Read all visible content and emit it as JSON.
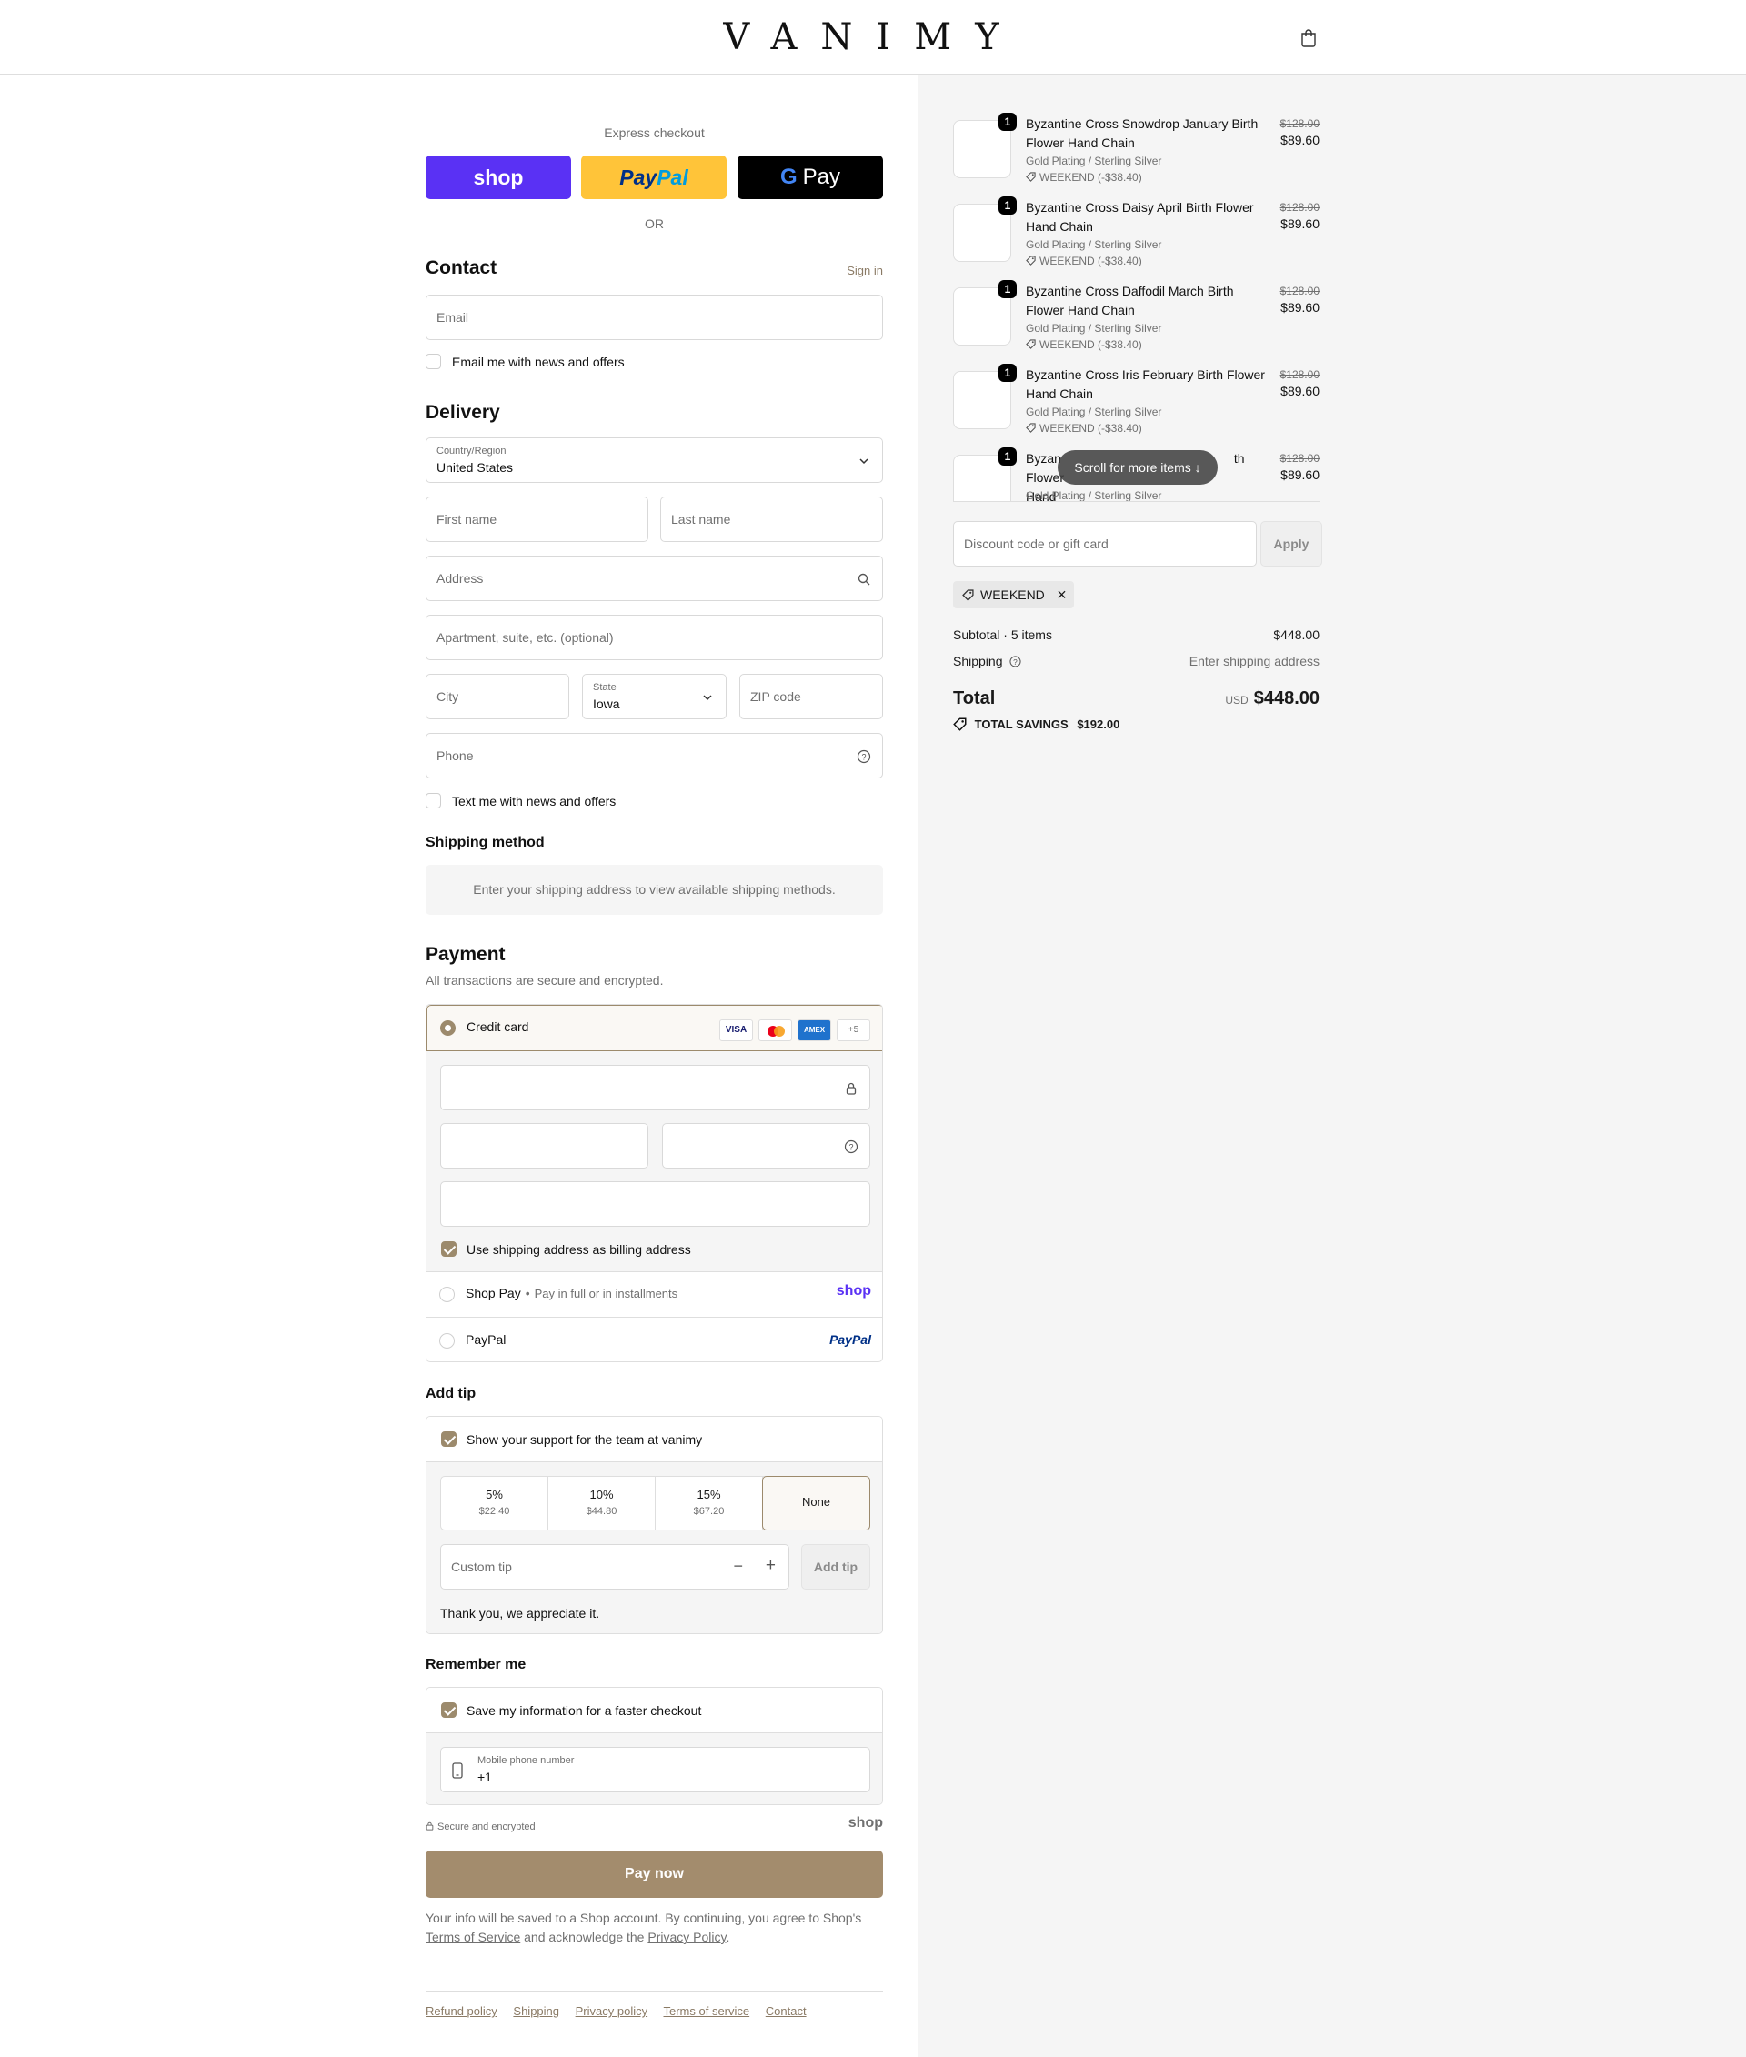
{
  "brand": {
    "logo": "VANIMY"
  },
  "express": {
    "label": "Express checkout",
    "shop": "shop",
    "paypal_a": "Pay",
    "paypal_b": "Pal",
    "gpay": "G Pay",
    "or": "OR"
  },
  "contact": {
    "title": "Contact",
    "sign_in": "Sign in",
    "email_placeholder": "Email",
    "news_label": "Email me with news and offers"
  },
  "delivery": {
    "title": "Delivery",
    "country_label": "Country/Region",
    "country_value": "United States",
    "first_name": "First name",
    "last_name": "Last name",
    "address": "Address",
    "apartment": "Apartment, suite, etc. (optional)",
    "city": "City",
    "state_label": "State",
    "state_value": "Iowa",
    "zip": "ZIP code",
    "phone": "Phone",
    "text_label": "Text me with news and offers"
  },
  "shipping_method": {
    "title": "Shipping method",
    "notice": "Enter your shipping address to view available shipping methods."
  },
  "payment": {
    "title": "Payment",
    "subtitle": "All transactions are secure and encrypted.",
    "credit_card": "Credit card",
    "card_badges": [
      "VISA",
      "MC",
      "AMEX",
      "+5"
    ],
    "billing_label": "Use shipping address as billing address",
    "shop_pay": "Shop Pay",
    "shop_pay_sub": "Pay in full or in installments",
    "shop_logo": "shop",
    "paypal": "PayPal",
    "paypal_logo": "PayPal"
  },
  "tip": {
    "title": "Add tip",
    "support_label": "Show your support for the team at vanimy",
    "options": [
      {
        "pct": "5%",
        "amt": "$22.40"
      },
      {
        "pct": "10%",
        "amt": "$44.80"
      },
      {
        "pct": "15%",
        "amt": "$67.20"
      },
      {
        "pct": "None",
        "amt": ""
      }
    ],
    "custom_placeholder": "Custom tip",
    "minus": "−",
    "plus": "+",
    "add_button": "Add tip",
    "thanks": "Thank you, we appreciate it."
  },
  "remember": {
    "title": "Remember me",
    "save_label": "Save my information for a faster checkout",
    "mobile_label": "Mobile phone number",
    "mobile_value": "+1",
    "secure": "Secure and encrypted",
    "shop_logo": "shop"
  },
  "pay_now": "Pay now",
  "legal": {
    "text1": "Your info will be saved to a Shop account. By continuing, you agree to Shop's",
    "terms": "Terms of Service",
    "text2": "and acknowledge the",
    "privacy": "Privacy Policy",
    "text3": "."
  },
  "footer": [
    "Refund policy",
    "Shipping",
    "Privacy policy",
    "Terms of service",
    "Contact"
  ],
  "items": [
    {
      "qty": "1",
      "name": "Byzantine Cross Snowdrop January Birth Flower Hand Chain",
      "variant": "Gold Plating / Sterling Silver",
      "discount": "WEEKEND (-$38.40)",
      "old": "$128.00",
      "new": "$89.60"
    },
    {
      "qty": "1",
      "name": "Byzantine Cross Daisy April Birth Flower Hand Chain",
      "variant": "Gold Plating / Sterling Silver",
      "discount": "WEEKEND (-$38.40)",
      "old": "$128.00",
      "new": "$89.60"
    },
    {
      "qty": "1",
      "name": "Byzantine Cross Daffodil March Birth Flower Hand Chain",
      "variant": "Gold Plating / Sterling Silver",
      "discount": "WEEKEND (-$38.40)",
      "old": "$128.00",
      "new": "$89.60"
    },
    {
      "qty": "1",
      "name": "Byzantine Cross Iris February Birth Flower Hand Chain",
      "variant": "Gold Plating / Sterling Silver",
      "discount": "WEEKEND (-$38.40)",
      "old": "$128.00",
      "new": "$89.60"
    },
    {
      "qty": "1",
      "name": "Byzantine Cross  Birth Flower Hand Chain",
      "name_visible_a": "Byzan",
      "name_visible_b": "th Flower",
      "name_visible_c": "Hand",
      "variant": "Gold Plating / Sterling Silver",
      "old": "$128.00",
      "new": "$89.60"
    }
  ],
  "scroll_pill": "Scroll for more items",
  "discount": {
    "placeholder": "Discount code or gift card",
    "apply": "Apply",
    "applied_code": "WEEKEND"
  },
  "totals": {
    "subtotal_label": "Subtotal · 5 items",
    "subtotal": "$448.00",
    "shipping_label": "Shipping",
    "shipping_value": "Enter shipping address",
    "total_label": "Total",
    "currency": "USD",
    "total": "$448.00",
    "savings_label": "TOTAL SAVINGS",
    "savings": "$192.00"
  },
  "colors": {
    "accent": "#a38c6d",
    "shop_purple": "#5a31f4",
    "paypal_yellow": "#ffc439"
  }
}
